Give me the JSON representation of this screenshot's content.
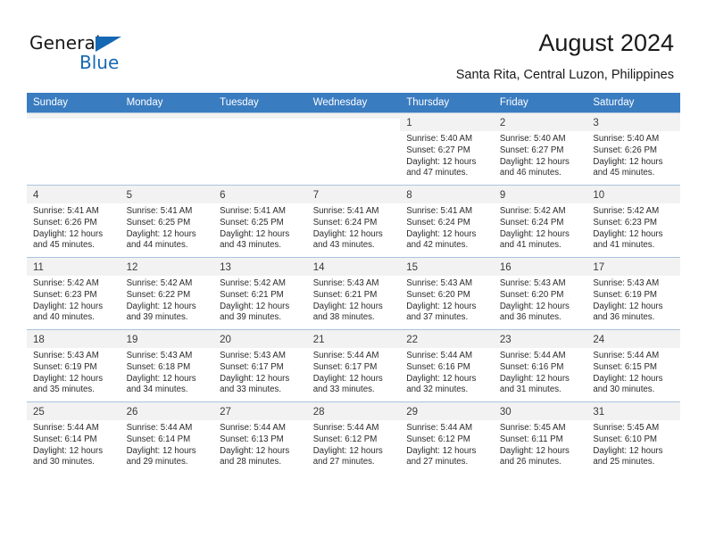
{
  "logo": {
    "word_general": "General",
    "word_blue": "Blue",
    "brand_color": "#1668b3"
  },
  "header": {
    "title": "August 2024",
    "subtitle": "Santa Rita, Central Luzon, Philippines"
  },
  "calendar": {
    "header_bg": "#3a7cc0",
    "header_text_color": "#ffffff",
    "weekdays": [
      "Sunday",
      "Monday",
      "Tuesday",
      "Wednesday",
      "Thursday",
      "Friday",
      "Saturday"
    ],
    "weeks": [
      [
        {
          "day": "",
          "sunrise": "",
          "sunset": "",
          "daylight_line1": "",
          "daylight_line2": ""
        },
        {
          "day": "",
          "sunrise": "",
          "sunset": "",
          "daylight_line1": "",
          "daylight_line2": ""
        },
        {
          "day": "",
          "sunrise": "",
          "sunset": "",
          "daylight_line1": "",
          "daylight_line2": ""
        },
        {
          "day": "",
          "sunrise": "",
          "sunset": "",
          "daylight_line1": "",
          "daylight_line2": ""
        },
        {
          "day": "1",
          "sunrise": "Sunrise: 5:40 AM",
          "sunset": "Sunset: 6:27 PM",
          "daylight_line1": "Daylight: 12 hours",
          "daylight_line2": "and 47 minutes."
        },
        {
          "day": "2",
          "sunrise": "Sunrise: 5:40 AM",
          "sunset": "Sunset: 6:27 PM",
          "daylight_line1": "Daylight: 12 hours",
          "daylight_line2": "and 46 minutes."
        },
        {
          "day": "3",
          "sunrise": "Sunrise: 5:40 AM",
          "sunset": "Sunset: 6:26 PM",
          "daylight_line1": "Daylight: 12 hours",
          "daylight_line2": "and 45 minutes."
        }
      ],
      [
        {
          "day": "4",
          "sunrise": "Sunrise: 5:41 AM",
          "sunset": "Sunset: 6:26 PM",
          "daylight_line1": "Daylight: 12 hours",
          "daylight_line2": "and 45 minutes."
        },
        {
          "day": "5",
          "sunrise": "Sunrise: 5:41 AM",
          "sunset": "Sunset: 6:25 PM",
          "daylight_line1": "Daylight: 12 hours",
          "daylight_line2": "and 44 minutes."
        },
        {
          "day": "6",
          "sunrise": "Sunrise: 5:41 AM",
          "sunset": "Sunset: 6:25 PM",
          "daylight_line1": "Daylight: 12 hours",
          "daylight_line2": "and 43 minutes."
        },
        {
          "day": "7",
          "sunrise": "Sunrise: 5:41 AM",
          "sunset": "Sunset: 6:24 PM",
          "daylight_line1": "Daylight: 12 hours",
          "daylight_line2": "and 43 minutes."
        },
        {
          "day": "8",
          "sunrise": "Sunrise: 5:41 AM",
          "sunset": "Sunset: 6:24 PM",
          "daylight_line1": "Daylight: 12 hours",
          "daylight_line2": "and 42 minutes."
        },
        {
          "day": "9",
          "sunrise": "Sunrise: 5:42 AM",
          "sunset": "Sunset: 6:24 PM",
          "daylight_line1": "Daylight: 12 hours",
          "daylight_line2": "and 41 minutes."
        },
        {
          "day": "10",
          "sunrise": "Sunrise: 5:42 AM",
          "sunset": "Sunset: 6:23 PM",
          "daylight_line1": "Daylight: 12 hours",
          "daylight_line2": "and 41 minutes."
        }
      ],
      [
        {
          "day": "11",
          "sunrise": "Sunrise: 5:42 AM",
          "sunset": "Sunset: 6:23 PM",
          "daylight_line1": "Daylight: 12 hours",
          "daylight_line2": "and 40 minutes."
        },
        {
          "day": "12",
          "sunrise": "Sunrise: 5:42 AM",
          "sunset": "Sunset: 6:22 PM",
          "daylight_line1": "Daylight: 12 hours",
          "daylight_line2": "and 39 minutes."
        },
        {
          "day": "13",
          "sunrise": "Sunrise: 5:42 AM",
          "sunset": "Sunset: 6:21 PM",
          "daylight_line1": "Daylight: 12 hours",
          "daylight_line2": "and 39 minutes."
        },
        {
          "day": "14",
          "sunrise": "Sunrise: 5:43 AM",
          "sunset": "Sunset: 6:21 PM",
          "daylight_line1": "Daylight: 12 hours",
          "daylight_line2": "and 38 minutes."
        },
        {
          "day": "15",
          "sunrise": "Sunrise: 5:43 AM",
          "sunset": "Sunset: 6:20 PM",
          "daylight_line1": "Daylight: 12 hours",
          "daylight_line2": "and 37 minutes."
        },
        {
          "day": "16",
          "sunrise": "Sunrise: 5:43 AM",
          "sunset": "Sunset: 6:20 PM",
          "daylight_line1": "Daylight: 12 hours",
          "daylight_line2": "and 36 minutes."
        },
        {
          "day": "17",
          "sunrise": "Sunrise: 5:43 AM",
          "sunset": "Sunset: 6:19 PM",
          "daylight_line1": "Daylight: 12 hours",
          "daylight_line2": "and 36 minutes."
        }
      ],
      [
        {
          "day": "18",
          "sunrise": "Sunrise: 5:43 AM",
          "sunset": "Sunset: 6:19 PM",
          "daylight_line1": "Daylight: 12 hours",
          "daylight_line2": "and 35 minutes."
        },
        {
          "day": "19",
          "sunrise": "Sunrise: 5:43 AM",
          "sunset": "Sunset: 6:18 PM",
          "daylight_line1": "Daylight: 12 hours",
          "daylight_line2": "and 34 minutes."
        },
        {
          "day": "20",
          "sunrise": "Sunrise: 5:43 AM",
          "sunset": "Sunset: 6:17 PM",
          "daylight_line1": "Daylight: 12 hours",
          "daylight_line2": "and 33 minutes."
        },
        {
          "day": "21",
          "sunrise": "Sunrise: 5:44 AM",
          "sunset": "Sunset: 6:17 PM",
          "daylight_line1": "Daylight: 12 hours",
          "daylight_line2": "and 33 minutes."
        },
        {
          "day": "22",
          "sunrise": "Sunrise: 5:44 AM",
          "sunset": "Sunset: 6:16 PM",
          "daylight_line1": "Daylight: 12 hours",
          "daylight_line2": "and 32 minutes."
        },
        {
          "day": "23",
          "sunrise": "Sunrise: 5:44 AM",
          "sunset": "Sunset: 6:16 PM",
          "daylight_line1": "Daylight: 12 hours",
          "daylight_line2": "and 31 minutes."
        },
        {
          "day": "24",
          "sunrise": "Sunrise: 5:44 AM",
          "sunset": "Sunset: 6:15 PM",
          "daylight_line1": "Daylight: 12 hours",
          "daylight_line2": "and 30 minutes."
        }
      ],
      [
        {
          "day": "25",
          "sunrise": "Sunrise: 5:44 AM",
          "sunset": "Sunset: 6:14 PM",
          "daylight_line1": "Daylight: 12 hours",
          "daylight_line2": "and 30 minutes."
        },
        {
          "day": "26",
          "sunrise": "Sunrise: 5:44 AM",
          "sunset": "Sunset: 6:14 PM",
          "daylight_line1": "Daylight: 12 hours",
          "daylight_line2": "and 29 minutes."
        },
        {
          "day": "27",
          "sunrise": "Sunrise: 5:44 AM",
          "sunset": "Sunset: 6:13 PM",
          "daylight_line1": "Daylight: 12 hours",
          "daylight_line2": "and 28 minutes."
        },
        {
          "day": "28",
          "sunrise": "Sunrise: 5:44 AM",
          "sunset": "Sunset: 6:12 PM",
          "daylight_line1": "Daylight: 12 hours",
          "daylight_line2": "and 27 minutes."
        },
        {
          "day": "29",
          "sunrise": "Sunrise: 5:44 AM",
          "sunset": "Sunset: 6:12 PM",
          "daylight_line1": "Daylight: 12 hours",
          "daylight_line2": "and 27 minutes."
        },
        {
          "day": "30",
          "sunrise": "Sunrise: 5:45 AM",
          "sunset": "Sunset: 6:11 PM",
          "daylight_line1": "Daylight: 12 hours",
          "daylight_line2": "and 26 minutes."
        },
        {
          "day": "31",
          "sunrise": "Sunrise: 5:45 AM",
          "sunset": "Sunset: 6:10 PM",
          "daylight_line1": "Daylight: 12 hours",
          "daylight_line2": "and 25 minutes."
        }
      ]
    ]
  }
}
